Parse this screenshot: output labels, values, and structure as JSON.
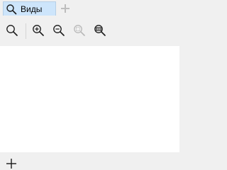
{
  "tabs": [
    {
      "label": "Виды",
      "icon": "search-icon",
      "active": true
    }
  ],
  "tab_add_icon": "plus-icon",
  "toolbar": {
    "buttons": [
      {
        "icon": "view-icon",
        "enabled": true
      },
      {
        "icon": "zoom-in-icon",
        "enabled": true
      },
      {
        "icon": "zoom-out-icon",
        "enabled": true
      },
      {
        "icon": "zoom-area-icon",
        "enabled": false
      },
      {
        "icon": "zoom-fit-icon",
        "enabled": true
      }
    ]
  },
  "bottom_add_icon": "plus-icon",
  "colors": {
    "active_tab": "#cde5fb",
    "chrome": "#f0f0f0",
    "content": "#ffffff"
  }
}
